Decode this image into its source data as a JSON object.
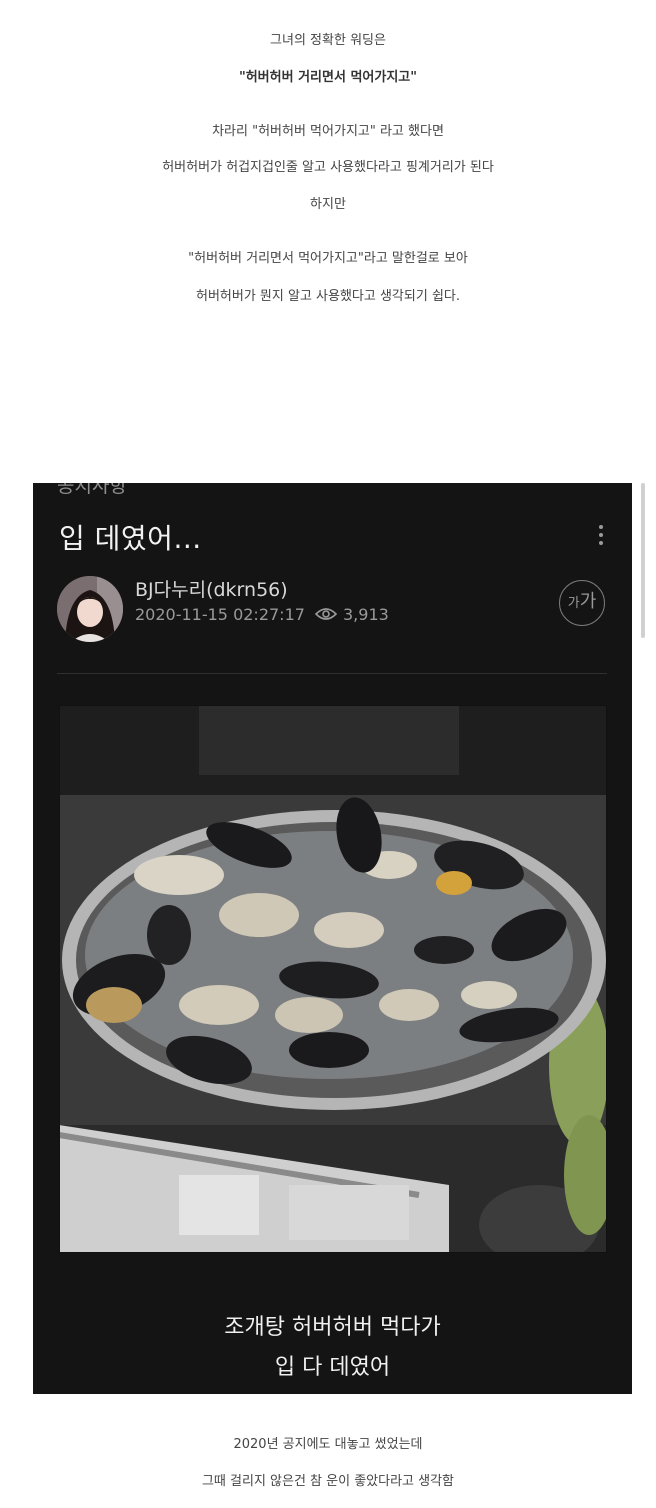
{
  "intro": {
    "line1": "그녀의 정확한 워딩은",
    "line2": "\"허버허버 거리면서 먹어가지고\"",
    "line3": "차라리 \"허버허버 먹어가지고\" 라고 했다면",
    "line4": "허버허버가 허겁지겁인줄 알고 사용했다라고 핑계거리가 된다",
    "line5": "하지만",
    "line6": "\"허버허버 거리면서 먹어가지고\"라고 말한걸로 보아",
    "line7": "허버허버가 뭔지 알고 사용했다고 생각되기 쉽다."
  },
  "post": {
    "board": "공지사항",
    "title": "입 데였어...",
    "author": "BJ다누리(dkrn56)",
    "datetime": "2020-11-15 02:27:17",
    "views": "3,913",
    "font_btn_small": "가",
    "font_btn_large": "가",
    "caption_line1": "조개탕 허버허버 먹다가",
    "caption_line2": "입 다 데였어"
  },
  "outro": {
    "line1": "2020년 공지에도 대놓고 썼었는데",
    "line2": "그때 걸리지 않은건 참 운이 좋았다라고 생각함"
  },
  "icons": {
    "more": "more-vertical-icon",
    "views": "eye-icon"
  },
  "colors": {
    "screenshot_bg": "#141414",
    "title_text": "#f2f2f2",
    "meta_text": "#9a9a9a"
  }
}
